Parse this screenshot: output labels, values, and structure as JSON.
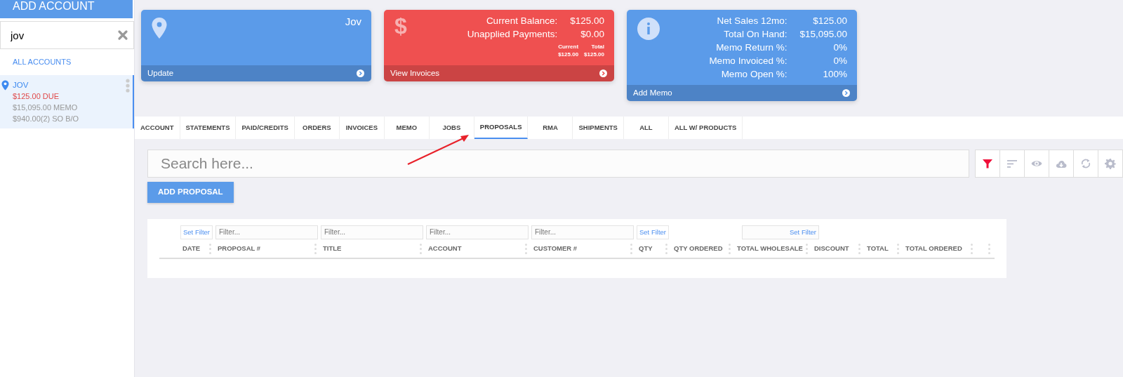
{
  "sidebar": {
    "header": "ADD ACCOUNT",
    "search": {
      "value": "jov"
    },
    "all_link": "ALL ACCOUNTS",
    "accounts": [
      {
        "name": "JOV",
        "due": "$125.00 DUE",
        "memo": "$15,095.00 MEMO",
        "backorder": "$940.00(2) SO B/O",
        "selected": true
      }
    ]
  },
  "cards": [
    {
      "kind": "location",
      "color": "#5b9be9",
      "title": "Jov",
      "footer": "Update"
    },
    {
      "kind": "balance",
      "color": "#ef5050",
      "icon": "$",
      "rows": [
        {
          "label": "Current Balance:",
          "value": "$125.00"
        },
        {
          "label": "Unapplied Payments:",
          "value": "$0.00"
        }
      ],
      "sub": [
        {
          "label": "Current",
          "value": "$125.00"
        },
        {
          "label": "Total",
          "value": "$125.00"
        }
      ],
      "footer": "View Invoices"
    },
    {
      "kind": "info",
      "color": "#5b9be9",
      "rows": [
        {
          "label": "Net Sales 12mo:",
          "value": "$125.00"
        },
        {
          "label": "Total On Hand:",
          "value": "$15,095.00"
        },
        {
          "label": "Memo Return %:",
          "value": "0%"
        },
        {
          "label": "Memo Invoiced %:",
          "value": "0%"
        },
        {
          "label": "Memo Open %:",
          "value": "100%"
        }
      ],
      "footer": "Add Memo"
    }
  ],
  "tabs": [
    {
      "label": "ACCOUNT",
      "selected": false
    },
    {
      "label": "STATEMENTS",
      "selected": false
    },
    {
      "label": "PAID/CREDITS",
      "selected": false
    },
    {
      "label": "ORDERS",
      "selected": false
    },
    {
      "label": "INVOICES",
      "selected": false
    },
    {
      "label": "MEMO",
      "selected": false
    },
    {
      "label": "JOBS",
      "selected": false
    },
    {
      "label": "PROPOSALS",
      "selected": true
    },
    {
      "label": "RMA",
      "selected": false
    },
    {
      "label": "SHIPMENTS",
      "selected": false
    },
    {
      "label": "ALL",
      "selected": false
    },
    {
      "label": "ALL W/ PRODUCTS",
      "selected": false
    }
  ],
  "search": {
    "placeholder": "Search here..."
  },
  "toolbar": [
    {
      "kind": "filter",
      "active": true
    },
    {
      "kind": "sort",
      "active": false
    },
    {
      "kind": "view",
      "active": false
    },
    {
      "kind": "download",
      "active": false
    },
    {
      "kind": "refresh",
      "active": false
    },
    {
      "kind": "settings",
      "active": false
    }
  ],
  "add_button": "ADD PROPOSAL",
  "table": {
    "columns": [
      {
        "label": "DATE",
        "filter": {
          "kind": "button",
          "label": "Set Filter"
        }
      },
      {
        "label": "PROPOSAL #",
        "filter": {
          "kind": "input",
          "placeholder": "Filter..."
        }
      },
      {
        "label": "TITLE",
        "filter": {
          "kind": "input",
          "placeholder": "Filter..."
        }
      },
      {
        "label": "ACCOUNT",
        "filter": {
          "kind": "input",
          "placeholder": "Filter..."
        }
      },
      {
        "label": "CUSTOMER #",
        "filter": {
          "kind": "input",
          "placeholder": "Filter..."
        }
      },
      {
        "label": "QTY",
        "filter": {
          "kind": "button",
          "label": "Set Filter"
        }
      },
      {
        "label": "QTY ORDERED"
      },
      {
        "label": "TOTAL WHOLESALE",
        "filter": {
          "kind": "wide",
          "label": "Set Filter"
        }
      },
      {
        "label": "DISCOUNT"
      },
      {
        "label": "TOTAL"
      },
      {
        "label": "TOTAL ORDERED"
      }
    ]
  }
}
